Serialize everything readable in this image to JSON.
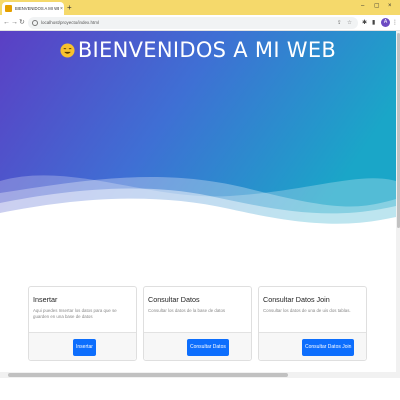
{
  "browser": {
    "tab": {
      "title": "BIENVENIDOS A MI WEB",
      "close": "×"
    },
    "new_tab": "+",
    "window_controls": {
      "minimize": "–",
      "restore": "▢",
      "close": "×"
    },
    "nav": {
      "back": "←",
      "forward": "→",
      "reload": "↻"
    },
    "address": {
      "url": "localhost/proyecto/index.html"
    },
    "profile_initial": "A",
    "accent": "#f5d96b"
  },
  "hero": {
    "title": "BIENVENIDOS A MI WEB",
    "gradient_start": "#5b3fc4",
    "gradient_end": "#1aa6c8"
  },
  "cards": [
    {
      "title": "Insertar",
      "text": "Aqui puedes Insertar los datos para que se guarden en una base de datos",
      "button": "Insertar"
    },
    {
      "title": "Consultar Datos",
      "text": "Consultar los datos de la base de datos",
      "button": "Consultar Datos"
    },
    {
      "title": "Consultar Datos Join",
      "text": "Consultar los datos de una de uis dos tablas.",
      "button": "Consultar Datos Join"
    }
  ],
  "colors": {
    "primary_button": "#0d6efd"
  }
}
